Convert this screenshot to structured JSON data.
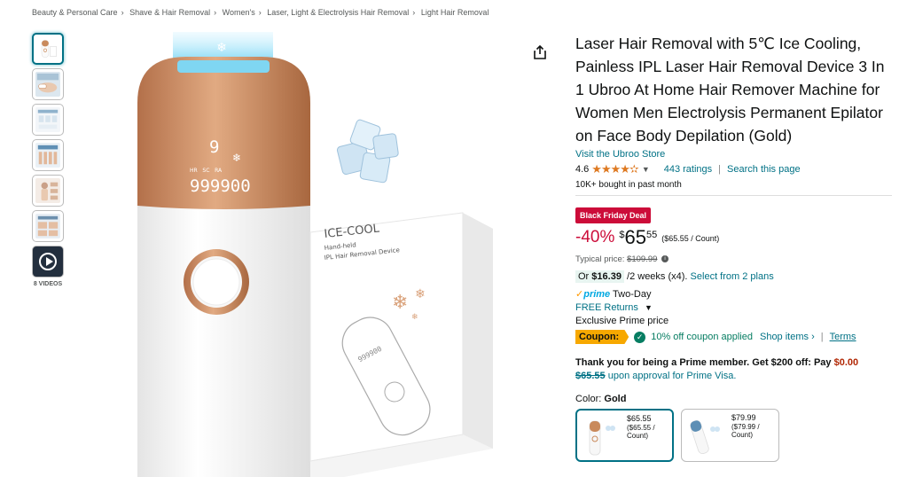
{
  "breadcrumb": [
    "Beauty & Personal Care",
    "Shave & Hair Removal",
    "Women's",
    "Laser, Light & Electrolysis Hair Removal",
    "Light Hair Removal"
  ],
  "gallery": {
    "videos_label": "8 VIDEOS"
  },
  "hero": {
    "box_title": "ICE-COOL",
    "box_sub1": "Hand-held",
    "box_sub2": "IPL Hair Removal Device",
    "display_level": "9",
    "display_modes": "HR   SC   RA",
    "display_count": "999900"
  },
  "product": {
    "title": "Laser Hair Removal with 5℃ Ice Cooling, Painless IPL Laser Hair Removal Device 3 In 1 Ubroo At Home Hair Remover Machine for Women Men Electrolysis Permanent Epilator on Face Body Depilation (Gold)",
    "store_link": "Visit the Ubroo Store",
    "rating": "4.6",
    "stars": "★★★★✫",
    "ratings_count": "443 ratings",
    "search_page": "Search this page",
    "bought": "10K+ bought in past month"
  },
  "pricing": {
    "deal_badge": "Black Friday Deal",
    "discount": "-40%",
    "currency": "$",
    "whole": "65",
    "fraction": "55",
    "unit_price": "($65.55 / Count)",
    "typical_label": "Typical price:",
    "typical_value": "$109.99",
    "installment_or": "Or",
    "installment_amount": "$16.39",
    "installment_rest": "/2 weeks (x4).",
    "installment_link": "Select from 2 plans",
    "prime_word": "prime",
    "prime_two_day": "Two-Day",
    "free_returns": "FREE Returns",
    "exclusive": "Exclusive Prime price",
    "coupon_label": "Coupon:",
    "coupon_text": "10% off coupon applied",
    "shop_items": "Shop items ›",
    "terms": "Terms",
    "prime_offer_bold": "Thank you for being a Prime member. Get $200 off: Pay",
    "prime_offer_zero": "$0.00",
    "prime_offer_old": "$65.55",
    "prime_offer_rest": "upon approval for Prime Visa."
  },
  "color": {
    "label": "Color:",
    "selected": "Gold",
    "swatches": [
      {
        "price": "$65.55",
        "unit": "($65.55 / Count)"
      },
      {
        "price": "$79.99",
        "unit": "($79.99 / Count)"
      }
    ]
  },
  "colors": {
    "link": "#007185",
    "deal": "#cc0c39",
    "star": "#de7921",
    "coupon": "#f7a800",
    "success": "#067d62",
    "device_gold": "#c98a5c"
  }
}
